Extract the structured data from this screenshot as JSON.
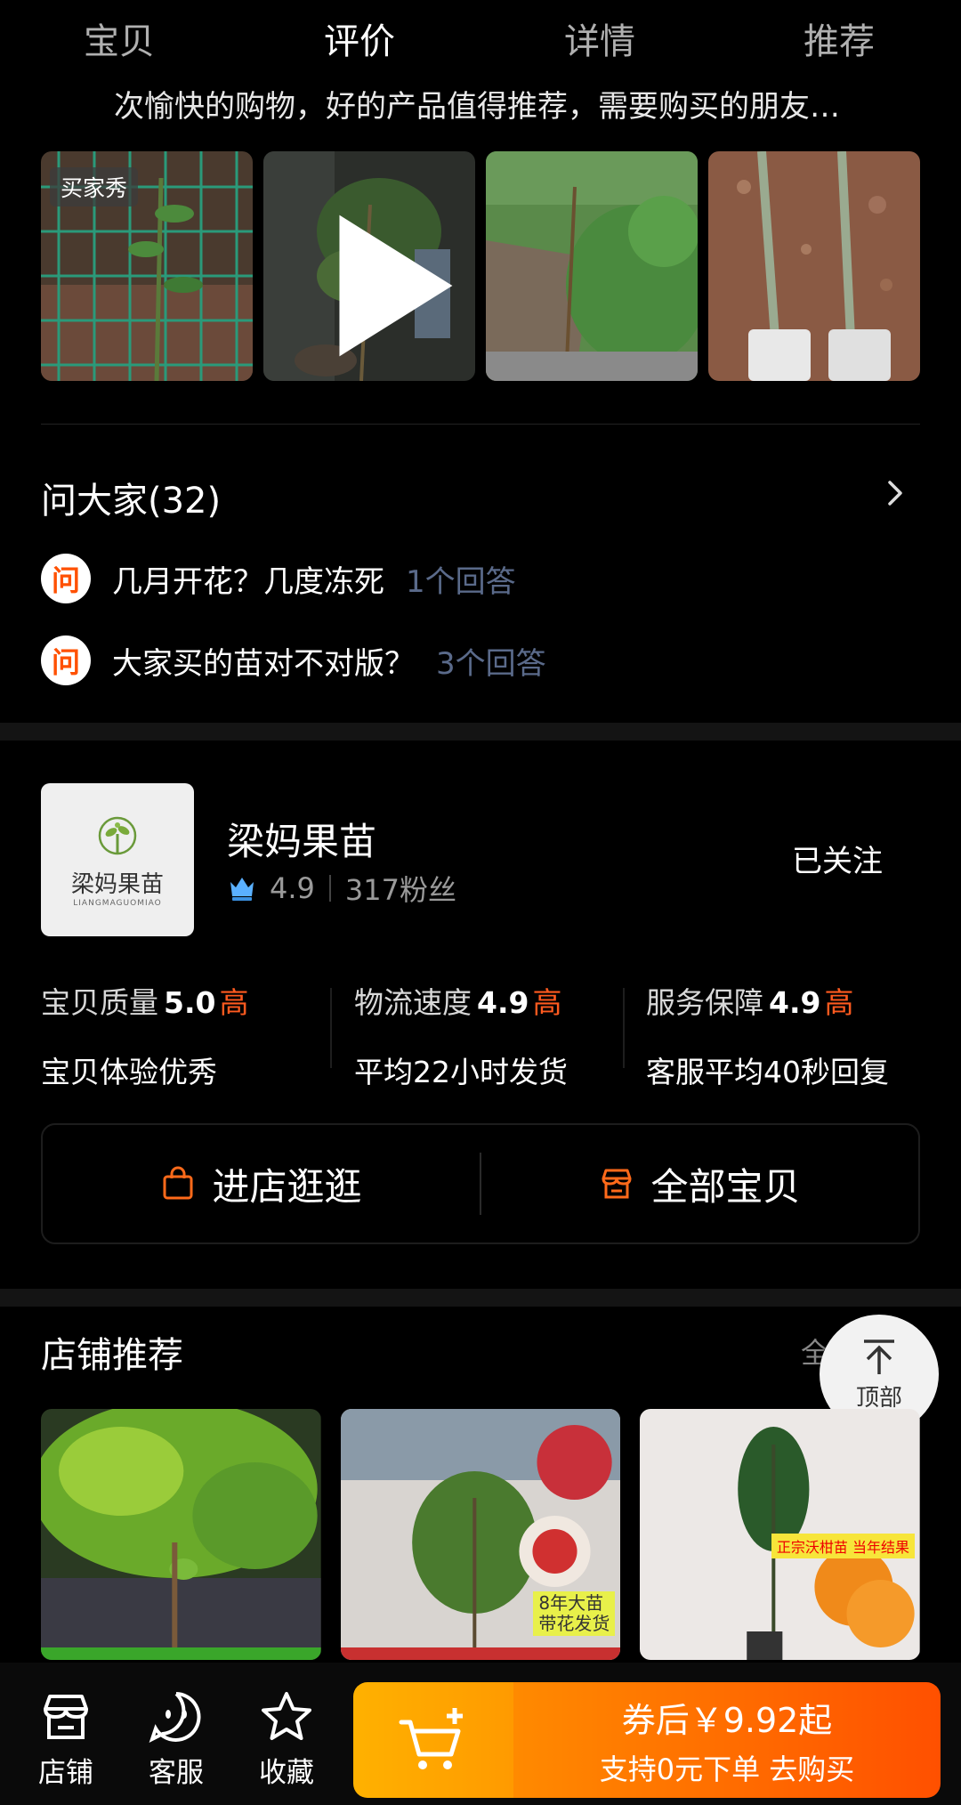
{
  "tabs": [
    "宝贝",
    "评价",
    "详情",
    "推荐"
  ],
  "review": {
    "snippet": "次愉快的购物，好的产品值得推荐，需要购买的朋友…",
    "buyer_show_label": "买家秀"
  },
  "qa": {
    "title": "问大家(32)",
    "badge": "问",
    "questions": [
      {
        "text": "几月开花？几度冻死",
        "answers": "1个回答"
      },
      {
        "text": "大家买的苗对不对版？",
        "answers": "3个回答"
      }
    ]
  },
  "shop": {
    "name": "梁妈果苗",
    "logo_text": "梁妈果苗",
    "logo_sub": "LIANGMAGUOMIAO",
    "rating": "4.9",
    "fans": "317粉丝",
    "follow_label": "已关注",
    "metrics": [
      {
        "label": "宝贝质量",
        "score": "5.0",
        "level": "高",
        "desc": "宝贝体验优秀"
      },
      {
        "label": "物流速度",
        "score": "4.9",
        "level": "高",
        "desc": "平均22小时发货"
      },
      {
        "label": "服务保障",
        "score": "4.9",
        "level": "高",
        "desc": "客服平均40秒回复"
      }
    ],
    "enter_shop": "进店逛逛",
    "all_items": "全部宝贝"
  },
  "recommend": {
    "title": "店铺推荐",
    "all_label": "全部",
    "top_label": "顶部",
    "card2_tag": "8年大苗\n带花发货",
    "card3_tag": "正宗沃柑苗 当年结果"
  },
  "bottom": {
    "shop_label": "店铺",
    "service_label": "客服",
    "fav_label": "收藏",
    "buy_line1": "券后￥9.92起",
    "buy_line2": "支持0元下单 去购买"
  },
  "colors": {
    "accent": "#ff5000",
    "high": "#ff5a1f",
    "answer": "#5a6a8a"
  }
}
